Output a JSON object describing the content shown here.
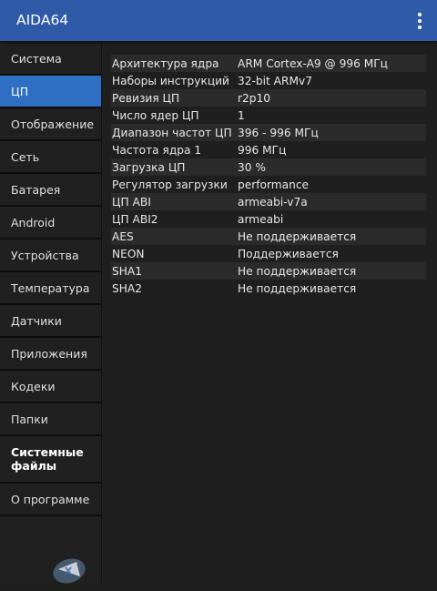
{
  "app": {
    "title": "AIDA64",
    "menu_icon": "more-vert-icon"
  },
  "sidebar": {
    "items": [
      {
        "label": "Система"
      },
      {
        "label": "ЦП",
        "active": true
      },
      {
        "label": "Отображение"
      },
      {
        "label": "Сеть"
      },
      {
        "label": "Батарея"
      },
      {
        "label": "Android"
      },
      {
        "label": "Устройства"
      },
      {
        "label": "Температура"
      },
      {
        "label": "Датчики"
      },
      {
        "label": "Приложения"
      },
      {
        "label": "Кодеки"
      },
      {
        "label": "Папки"
      },
      {
        "label": "Системные\nфайлы",
        "bold": true
      },
      {
        "label": "О программе"
      }
    ]
  },
  "cpu": {
    "rows": [
      {
        "key": "Архитектура ядра",
        "value": "ARM Cortex-A9 @ 996 МГц"
      },
      {
        "key": "Наборы инструкций",
        "value": "32-bit ARMv7"
      },
      {
        "key": "Ревизия ЦП",
        "value": "r2p10"
      },
      {
        "key": "Число ядер ЦП",
        "value": "1"
      },
      {
        "key": "Диапазон частот ЦП",
        "value": "396 - 996 МГц"
      },
      {
        "key": "Частота ядра 1",
        "value": "996 МГц"
      },
      {
        "key": "Загрузка ЦП",
        "value": "30 %"
      },
      {
        "key": "Регулятор загрузки",
        "value": "performance"
      },
      {
        "key": "ЦП ABI",
        "value": "armeabi-v7a"
      },
      {
        "key": "ЦП ABI2",
        "value": "armeabi"
      },
      {
        "key": "AES",
        "value": "Не поддерживается"
      },
      {
        "key": "NEON",
        "value": "Поддерживается"
      },
      {
        "key": "SHA1",
        "value": "Не поддерживается"
      },
      {
        "key": "SHA2",
        "value": "Не поддерживается"
      }
    ]
  },
  "colors": {
    "appbar": "#2e5aa8",
    "active_nav": "#2e6fc3",
    "background": "#1f1f1f"
  }
}
